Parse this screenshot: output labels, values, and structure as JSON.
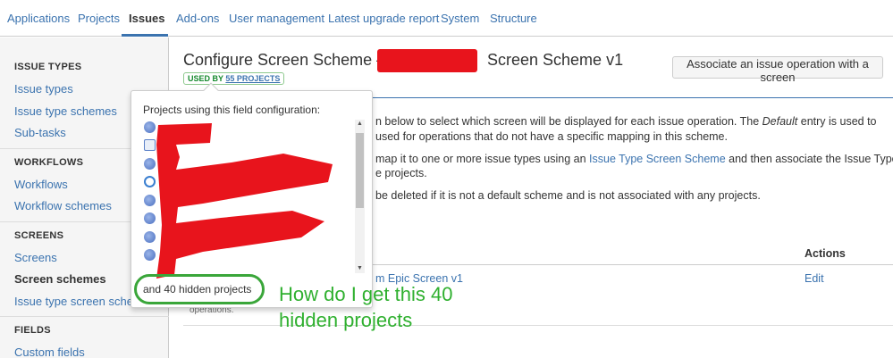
{
  "topnav": {
    "tabs": [
      "Applications",
      "Projects",
      "Issues",
      "Add-ons",
      "User management",
      "Latest upgrade report",
      "System",
      "Structure"
    ],
    "active": "Issues"
  },
  "sidebar": {
    "sections": [
      {
        "title": "ISSUE TYPES",
        "items": [
          "Issue types",
          "Issue type schemes",
          "Sub-tasks"
        ]
      },
      {
        "title": "WORKFLOWS",
        "items": [
          "Workflows",
          "Workflow schemes"
        ]
      },
      {
        "title": "SCREENS",
        "items": [
          "Screens",
          "Screen schemes",
          "Issue type screen scheme"
        ]
      },
      {
        "title": "FIELDS",
        "items": [
          "Custom fields"
        ]
      }
    ],
    "active_item": "Screen schemes"
  },
  "main": {
    "title_prefix": "Configure Screen Scheme —",
    "title_suffix": "Screen Scheme v1",
    "used_by_label": "USED BY",
    "used_by_count": "55 PROJECTS",
    "associate_button": "Associate an issue operation with a screen",
    "desc_line1_a": "n below to select which screen will be displayed for each issue operation. The ",
    "desc_line1_em": "Default",
    "desc_line1_b": " entry is used to",
    "desc_line2": "used for operations that do not have a specific mapping in this scheme.",
    "desc_line3_a": "map it to one or more issue types using an ",
    "desc_line3_link": "Issue Type Screen Scheme",
    "desc_line3_b": " and then associate the Issue Type",
    "desc_line4": "e projects.",
    "desc_line5": "be deleted if it is not a default scheme and is not associated with any projects.",
    "table_header_actions": "Actions",
    "row_screen_link": "m Epic Screen v1",
    "row_edit": "Edit",
    "row_subtext": "operations."
  },
  "popup": {
    "heading": "Projects using this field configuration:",
    "hidden_projects": "and 40 hidden projects"
  },
  "annotation": {
    "line1": "How do I get this 40",
    "line2": "hidden projects"
  },
  "colors": {
    "link": "#3b73af",
    "redaction": "#e8141c",
    "annotation": "#2fb02f"
  }
}
